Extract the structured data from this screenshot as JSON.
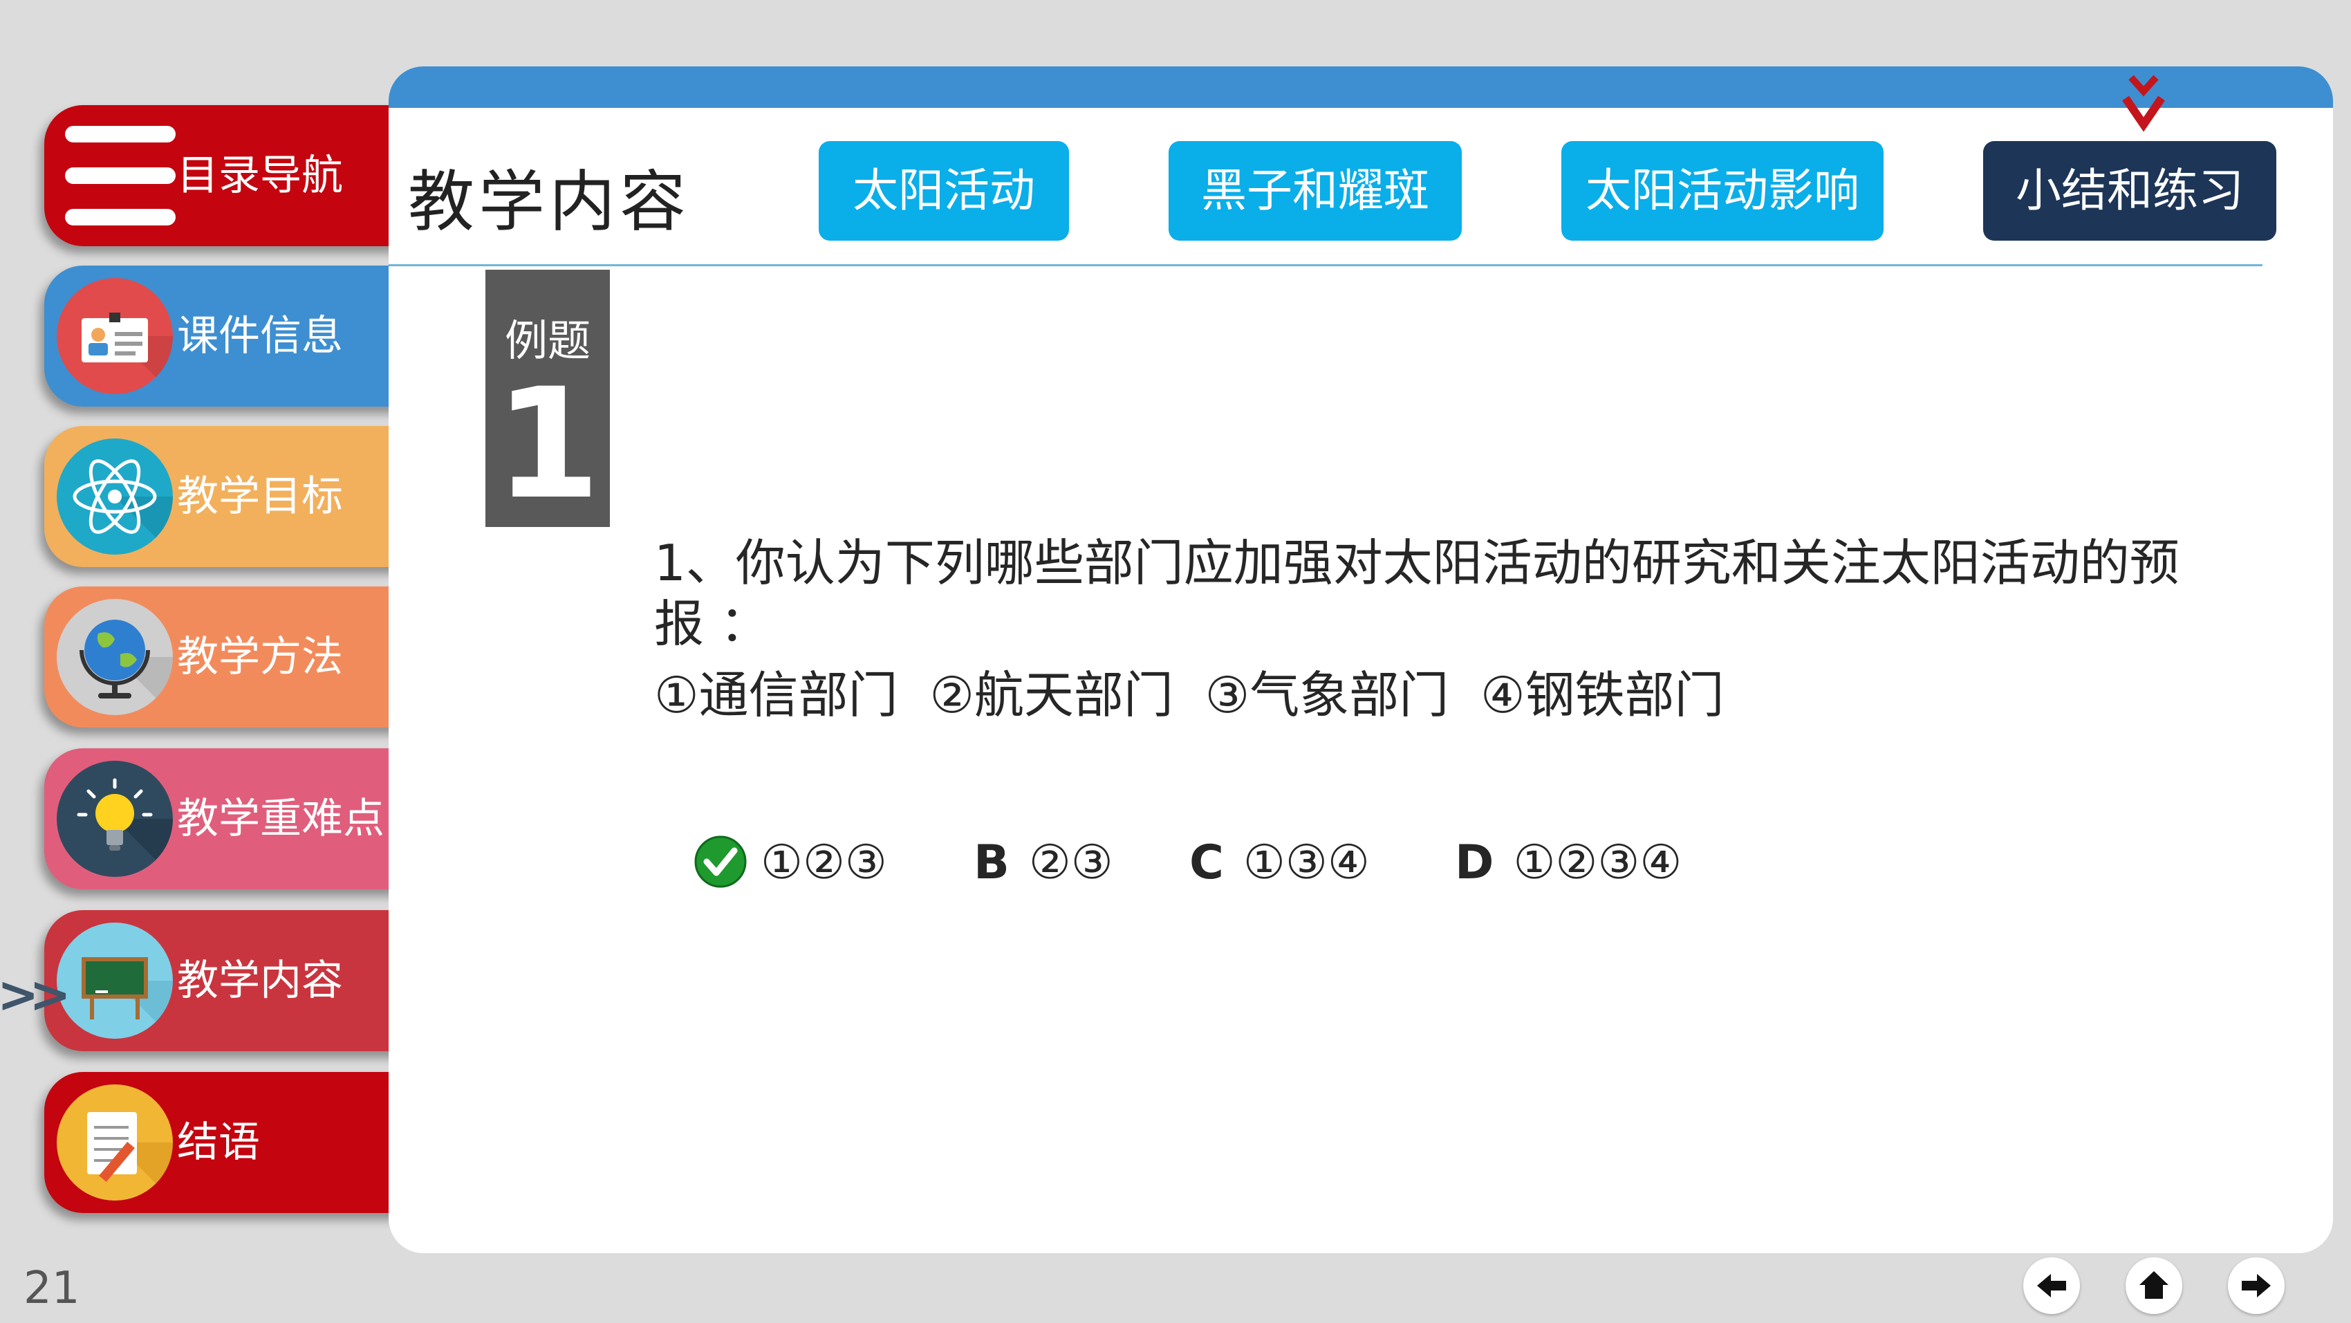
{
  "sidebar": {
    "items": [
      {
        "label": "目录导航",
        "color": "#c4050f",
        "icon": "menu-icon"
      },
      {
        "label": "课件信息",
        "color": "#3d8fd1",
        "icon": "id-card-icon"
      },
      {
        "label": "教学目标",
        "color": "#f2b05c",
        "icon": "atom-icon"
      },
      {
        "label": "教学方法",
        "color": "#f28b5c",
        "icon": "globe-icon"
      },
      {
        "label": "教学重难点",
        "color": "#e05e7c",
        "icon": "lightbulb-icon"
      },
      {
        "label": "教学内容",
        "color": "#c9353e",
        "icon": "blackboard-icon"
      },
      {
        "label": "结语",
        "color": "#c4050f",
        "icon": "notepad-icon"
      }
    ],
    "current_marker": ">>"
  },
  "panel": {
    "title": "教学内容",
    "tabs": [
      {
        "label": "太阳活动",
        "active": false
      },
      {
        "label": "黑子和耀斑",
        "active": false
      },
      {
        "label": "太阳活动影响",
        "active": false
      },
      {
        "label": "小结和练习",
        "active": true
      }
    ],
    "active_marker": "v v"
  },
  "example": {
    "label": "例题",
    "number": "1"
  },
  "question": {
    "text": "1、你认为下列哪些部门应加强对太阳活动的研究和关注太阳活动的预报 ：",
    "options": "①通信部门  ②航天部门  ③气象部门  ④钢铁部门"
  },
  "answers": [
    {
      "letter": "",
      "value": "①②③",
      "correct": true
    },
    {
      "letter": "B",
      "value": "②③",
      "correct": false
    },
    {
      "letter": "C",
      "value": "①③④",
      "correct": false
    },
    {
      "letter": "D",
      "value": "①②③④",
      "correct": false
    }
  ],
  "footer": {
    "page_number": "21"
  },
  "colors": {
    "tab_blue": "#0aaee9",
    "tab_active": "#1d3557",
    "topbar": "#3d8fd1",
    "marker_red": "#c4151c"
  }
}
